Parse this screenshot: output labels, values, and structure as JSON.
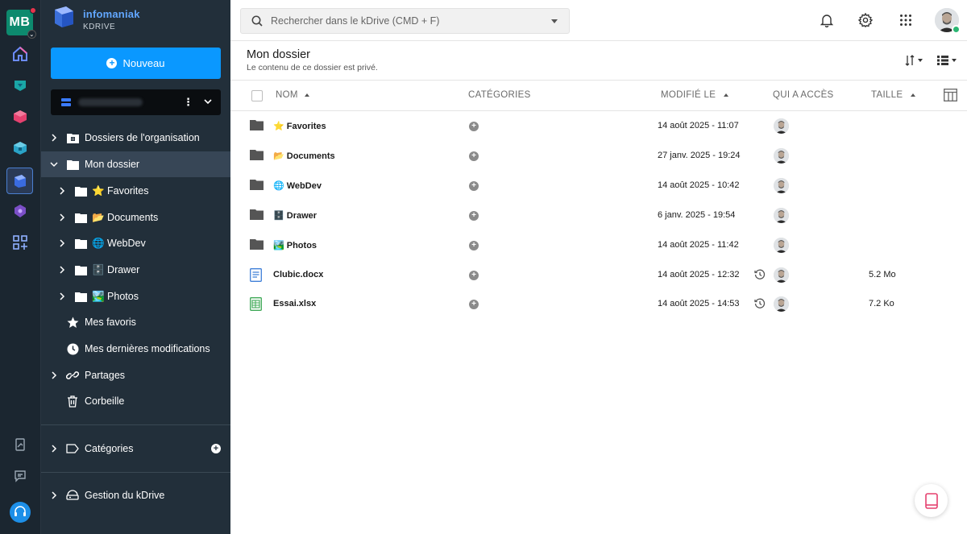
{
  "rail": {
    "avatar_initials": "MB",
    "icons": [
      "home-icon",
      "kchat-icon",
      "kmail-icon",
      "kdrive-icon",
      "kdrive-app-icon",
      "kmeet-icon",
      "add-app-icon",
      "report-icon",
      "feedback-icon",
      "support-icon"
    ]
  },
  "brand": {
    "name": "infomaniak",
    "product": "KDRIVE"
  },
  "sidebar": {
    "new_button": "Nouveau",
    "tree": [
      {
        "label": "Dossiers de l'organisation",
        "icon": "org-folder-icon"
      },
      {
        "label": "Mon dossier",
        "icon": "folder-icon"
      },
      {
        "label": "⭐️ Favorites",
        "icon": "folder-icon"
      },
      {
        "label": "📂 Documents",
        "icon": "folder-icon"
      },
      {
        "label": "🌐 WebDev",
        "icon": "folder-icon"
      },
      {
        "label": "🗄️ Drawer",
        "icon": "folder-icon"
      },
      {
        "label": "🏞️ Photos",
        "icon": "folder-icon"
      },
      {
        "label": "Mes favoris",
        "icon": "star-icon"
      },
      {
        "label": "Mes dernières modifications",
        "icon": "clock-icon"
      },
      {
        "label": "Partages",
        "icon": "link-icon"
      },
      {
        "label": "Corbeille",
        "icon": "trash-icon"
      }
    ],
    "categories_label": "Catégories",
    "manage_label": "Gestion du kDrive"
  },
  "search": {
    "placeholder": "Rechercher dans le kDrive (CMD + F)"
  },
  "header": {
    "title": "Mon dossier",
    "subtitle": "Le contenu de ce dossier est privé."
  },
  "table": {
    "columns": {
      "name": "NOM",
      "categories": "CATÉGORIES",
      "modified": "MODIFIÉ LE",
      "access": "QUI A ACCÈS",
      "size": "TAILLE"
    },
    "rows": [
      {
        "name": "⭐️ Favorites",
        "type": "folder",
        "modified": "14 août 2025 - 11:07",
        "size": ""
      },
      {
        "name": "📂 Documents",
        "type": "folder",
        "modified": "27 janv. 2025 - 19:24",
        "size": ""
      },
      {
        "name": "🌐 WebDev",
        "type": "folder",
        "modified": "14 août 2025 - 10:42",
        "size": ""
      },
      {
        "name": "🗄️ Drawer",
        "type": "folder",
        "modified": "6 janv. 2025 - 19:54",
        "size": ""
      },
      {
        "name": "🏞️ Photos",
        "type": "folder",
        "modified": "14 août 2025 - 11:42",
        "size": ""
      },
      {
        "name": "Clubic.docx",
        "type": "docx",
        "modified": "14 août 2025 - 12:32",
        "size": "5.2 Mo"
      },
      {
        "name": "Essai.xlsx",
        "type": "xlsx",
        "modified": "14 août 2025 - 14:53",
        "size": "7.2 Ko"
      }
    ]
  },
  "colors": {
    "accent": "#0a98ff",
    "sidebar_bg": "#222f3a",
    "rail_bg": "#1b2630",
    "selected_bg": "#374656"
  }
}
